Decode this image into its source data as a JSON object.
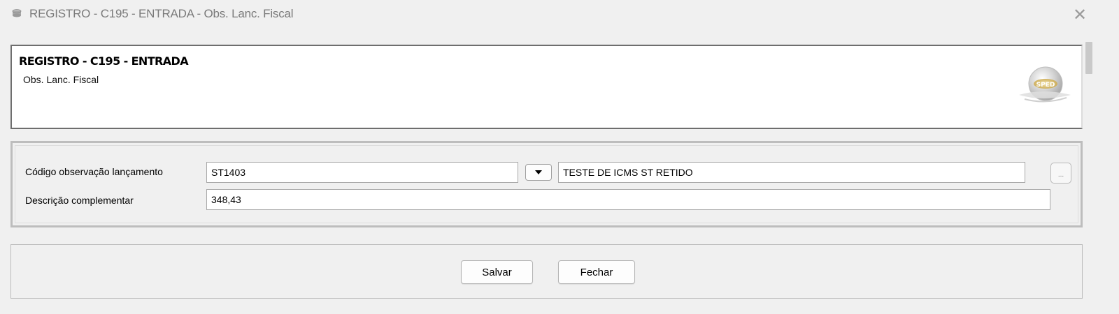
{
  "window": {
    "title": "REGISTRO - C195 - ENTRADA - Obs. Lanc. Fiscal",
    "close_glyph": "✕",
    "icon": "app-icon"
  },
  "header": {
    "title": "REGISTRO - C195 - ENTRADA",
    "subtitle": "Obs. Lanc. Fiscal",
    "logo_text": "SPED",
    "logo_icon": "sped-globe-logo"
  },
  "form": {
    "codigo_label": "Código observação lançamento",
    "codigo_value": "ST1403",
    "codigo_dropdown_icon": "dropdown-arrow-icon",
    "codigo_description": "TESTE DE ICMS ST RETIDO",
    "lookup_label": "...",
    "descricao_label": "Descrição complementar",
    "descricao_value": "348,43"
  },
  "footer": {
    "save_label": "Salvar",
    "close_label": "Fechar"
  },
  "colors": {
    "window_bg": "#f0f0f0",
    "panel_bg": "#ffffff",
    "title_text": "#7a7a7a"
  }
}
